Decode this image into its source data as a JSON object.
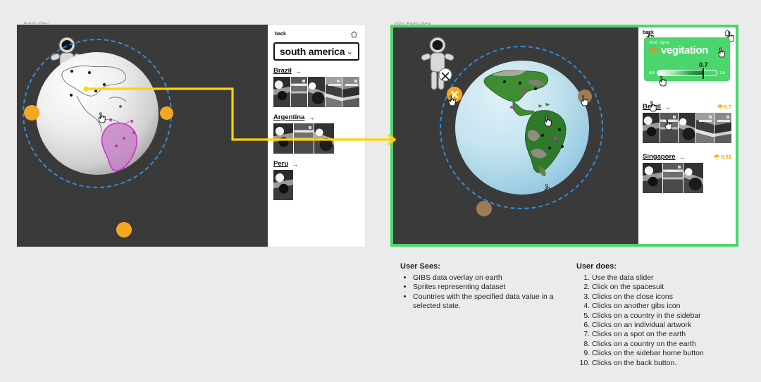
{
  "panels": {
    "left_caption": "Earth View",
    "right_caption": "Gibs Earth View"
  },
  "left_sidebar": {
    "back_label": "back",
    "home_icon": "home-icon",
    "select": {
      "value": "south america",
      "caret": "chevron-down-icon"
    },
    "countries": [
      {
        "name": "Brazil",
        "arrow": "→",
        "thumb_count": 5
      },
      {
        "name": "Argentina",
        "arrow": "→",
        "thumb_count": 3
      },
      {
        "name": "Peru",
        "arrow": "→",
        "thumb_count": 1
      }
    ]
  },
  "right_sidebar": {
    "back_label": "back",
    "home_icon": "home-icon",
    "vital_signs": {
      "eyebrow": "vital signs:",
      "title": "vegitation",
      "plant_icon": "plant-icon",
      "slider_min": "0.0",
      "slider_max": "1.0",
      "slider_value": "0.7",
      "fill_color": "#147a33",
      "card_color": "#4ad66d"
    },
    "countries": [
      {
        "name": "Brazil",
        "arrow": "→",
        "value": "0.7",
        "thumb_count": 5
      },
      {
        "name": "Singapore",
        "arrow": "→",
        "value": "0.62",
        "thumb_count": 3
      }
    ]
  },
  "explanations": {
    "user_sees": {
      "title": "User Sees:",
      "items": [
        "GIBS data overlay on earth",
        "Sprites representing dataset",
        "Countries with the specified data value in a selected state."
      ]
    },
    "user_does": {
      "title": "User does:",
      "items": [
        "Use the data slider",
        "Click on the spacesuit",
        "Clicks on the close icons",
        "Clicks on another gibs icon",
        "Clicks on a country in the sidebar",
        "Clicks on an individual artwork",
        "Clicks on a spot on the earth",
        "Clicks on a country on the earth",
        "Clicks on the sidebar home button",
        "Clicks on the back button."
      ]
    }
  },
  "colors": {
    "accent_green": "#4ad66d",
    "orbit_blue": "#2e8ee0",
    "node_orange": "#f5a623",
    "node_brown": "#9d7e54",
    "connector_yellow": "#ffd400",
    "highlight_magenta": "#c85cc8",
    "value_gold": "#f0a500"
  }
}
